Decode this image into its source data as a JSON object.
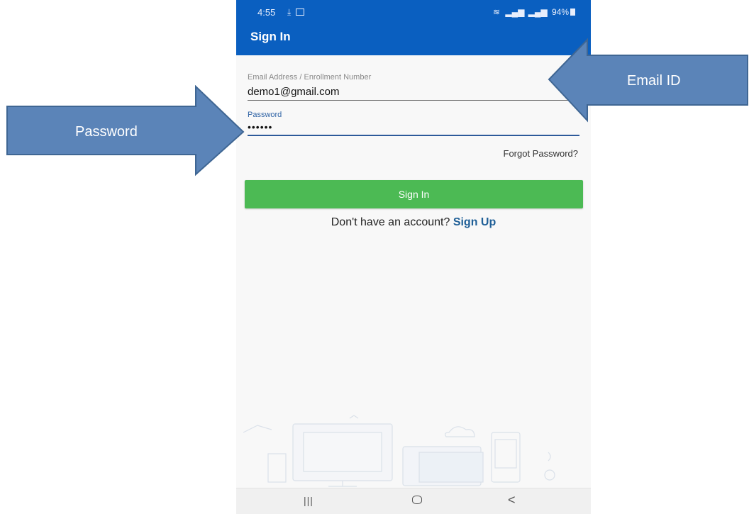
{
  "status_bar": {
    "time": "4:55",
    "battery": "94%"
  },
  "app_bar": {
    "title": "Sign In"
  },
  "form": {
    "email_label": "Email Address / Enrollment Number",
    "email_value": "demo1@gmail.com",
    "password_label": "Password",
    "password_value": "••••••",
    "forgot_link": "Forgot Password?",
    "sign_in_button": "Sign In",
    "no_account_text": "Don't have an account?",
    "sign_up_link": "Sign Up"
  },
  "callouts": {
    "email": "Email ID",
    "password": "Password"
  },
  "colors": {
    "app_bar": "#0a5fc0",
    "button": "#4cba54",
    "arrow_fill": "#5b84b8",
    "arrow_stroke": "#3f6693",
    "link": "#1f5f97"
  }
}
